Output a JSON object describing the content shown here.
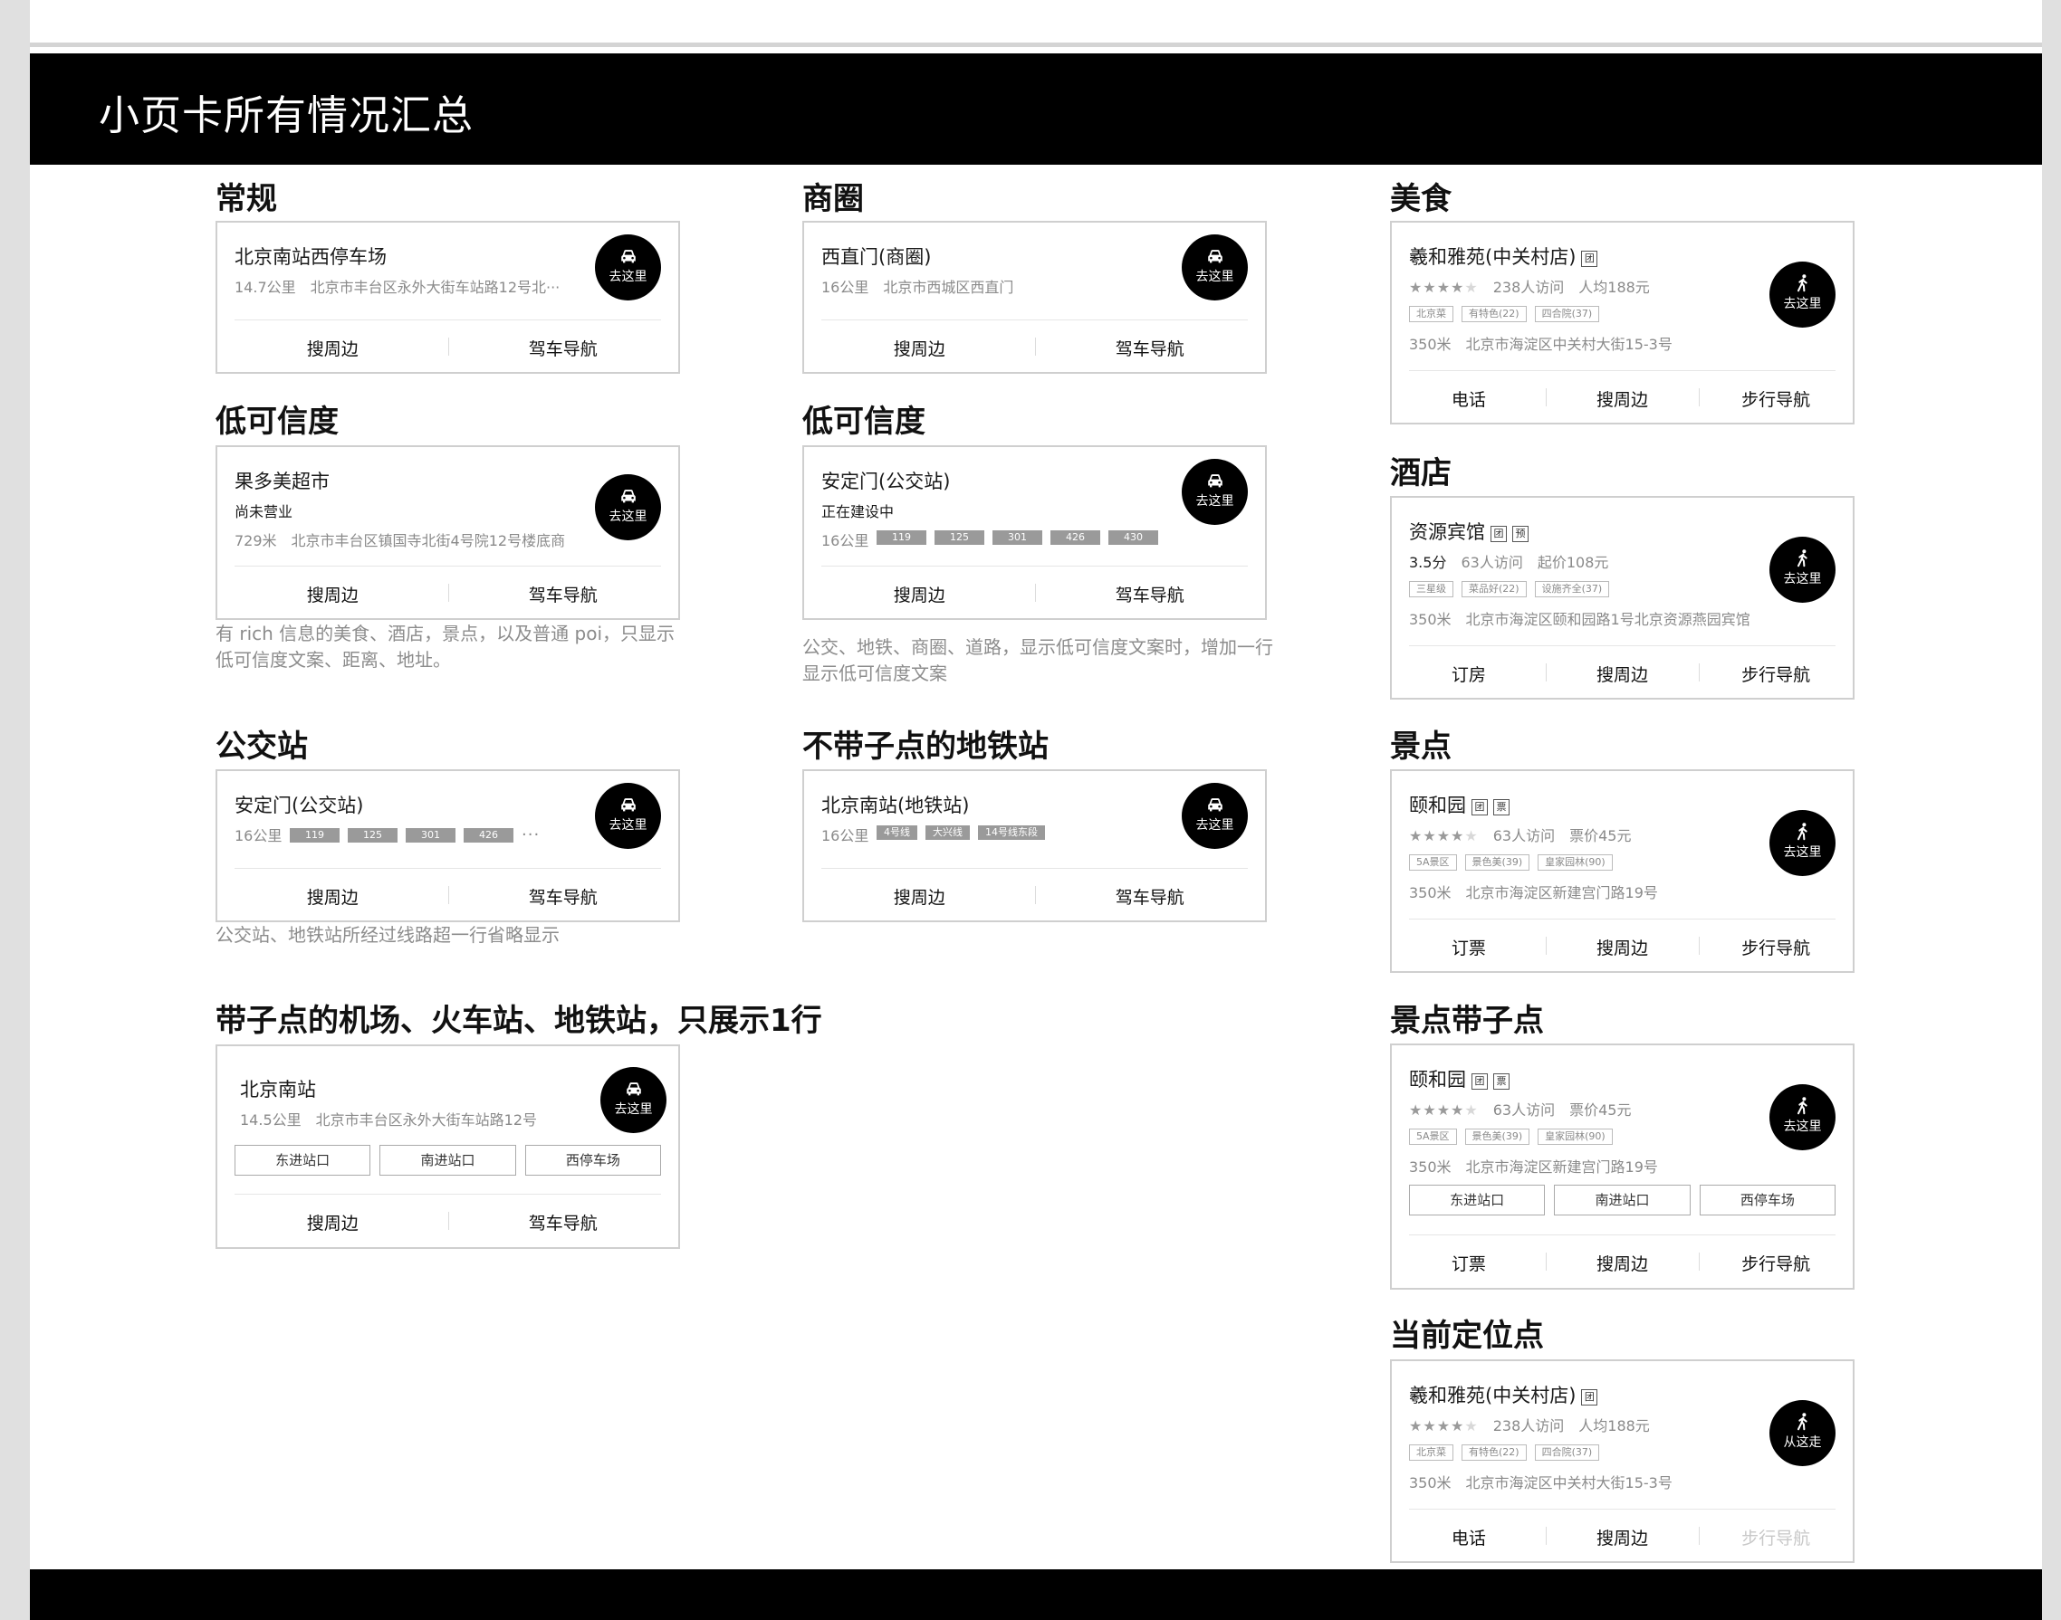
{
  "page_title": "小页卡所有情况汇总",
  "buttons": {
    "go": "去这里",
    "from": "从这走"
  },
  "actions": {
    "search": "搜周边",
    "drive": "驾车导航",
    "walk": "步行导航",
    "phone": "电话",
    "book_room": "订房",
    "book_ticket": "订票"
  },
  "normal": {
    "title": "常规",
    "name": "北京南站西停车场",
    "distance": "14.7公里",
    "address": "北京市丰台区永外大街车站路12号北···"
  },
  "district": {
    "title": "商圈",
    "name": "西直门(商圈)",
    "distance": "16公里",
    "address": "北京市西城区西直门"
  },
  "low1": {
    "title": "低可信度",
    "name": "果多美超市",
    "status": "尚未营业",
    "distance": "729米",
    "address": "北京市丰台区镇国寺北街4号院12号楼底商",
    "note": "有 rich 信息的美食、酒店，景点，以及普通 poi，只显示低可信度文案、距离、地址。"
  },
  "low2": {
    "title": "低可信度",
    "name": "安定门(公交站)",
    "status": "正在建设中",
    "distance": "16公里",
    "lines": [
      "119",
      "125",
      "301",
      "426",
      "430"
    ],
    "note": "公交、地铁、商圈、道路，显示低可信度文案时，增加一行显示低可信度文案"
  },
  "bus": {
    "title": "公交站",
    "name": "安定门(公交站)",
    "distance": "16公里",
    "lines": [
      "119",
      "125",
      "301",
      "426"
    ],
    "more": "···",
    "note": "公交站、地铁站所经过线路超一行省略显示"
  },
  "subway": {
    "title": "不带子点的地铁站",
    "name": "北京南站(地铁站)",
    "distance": "16公里",
    "lines": [
      "4号线",
      "大兴线",
      "14号线东段"
    ]
  },
  "station": {
    "title": "带子点的机场、火车站、地铁站，只展示1行",
    "name": "北京南站",
    "distance": "14.5公里",
    "address": "北京市丰台区永外大街车站路12号",
    "entrances": [
      "东进站口",
      "南进站口",
      "西停车场"
    ]
  },
  "food": {
    "title": "美食",
    "name": "羲和雅苑(中关村店)",
    "badges": [
      "团"
    ],
    "visits": "238人访问",
    "price": "人均188元",
    "rating": 4,
    "tags": [
      "北京菜",
      "有特色(22)",
      "四合院(37)"
    ],
    "distance": "350米",
    "address": "北京市海淀区中关村大街15-3号"
  },
  "hotel": {
    "title": "酒店",
    "name": "资源宾馆",
    "badges": [
      "团",
      "预"
    ],
    "score": "3.5分",
    "visits": "63人访问",
    "price": "起价108元",
    "tags": [
      "三星级",
      "菜品好(22)",
      "设施齐全(37)"
    ],
    "distance": "350米",
    "address": "北京市海淀区颐和园路1号北京资源燕园宾馆"
  },
  "scenic": {
    "title": "景点",
    "name": "颐和园",
    "badges": [
      "团",
      "票"
    ],
    "visits": "63人访问",
    "price": "票价45元",
    "rating": 4,
    "tags": [
      "5A景区",
      "景色美(39)",
      "皇家园林(90)"
    ],
    "distance": "350米",
    "address": "北京市海淀区新建宫门路19号"
  },
  "scenic_sub": {
    "title": "景点带子点",
    "name": "颐和园",
    "badges": [
      "团",
      "票"
    ],
    "visits": "63人访问",
    "price": "票价45元",
    "rating": 4,
    "tags": [
      "5A景区",
      "景色美(39)",
      "皇家园林(90)"
    ],
    "distance": "350米",
    "address": "北京市海淀区新建宫门路19号",
    "entrances": [
      "东进站口",
      "南进站口",
      "西停车场"
    ]
  },
  "current": {
    "title": "当前定位点",
    "name": "羲和雅苑(中关村店)",
    "badges": [
      "团"
    ],
    "visits": "238人访问",
    "price": "人均188元",
    "rating": 4,
    "tags": [
      "北京菜",
      "有特色(22)",
      "四合院(37)"
    ],
    "distance": "350米",
    "address": "北京市海淀区中关村大街15-3号"
  }
}
